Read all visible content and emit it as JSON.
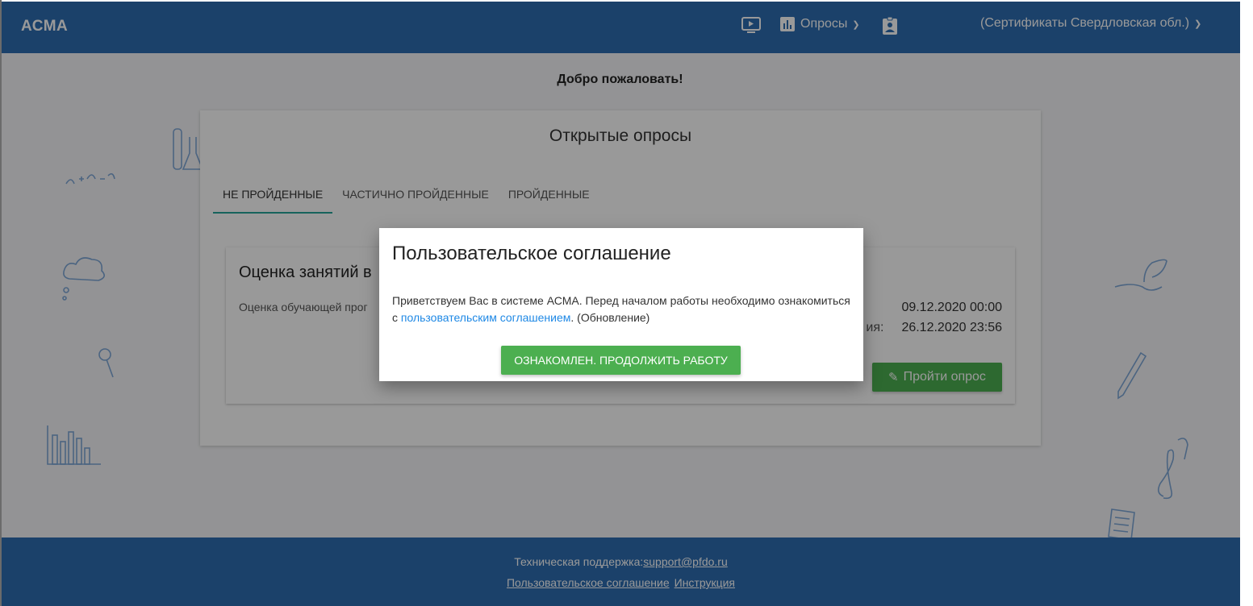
{
  "header": {
    "brand": "АСМА",
    "surveys_label": "Опросы",
    "account_label": "(Сертификаты Свердловская обл.)"
  },
  "main": {
    "welcome": "Добро пожаловать!",
    "card_title": "Открытые опросы",
    "tabs": [
      {
        "label": "НЕ ПРОЙДЕННЫЕ",
        "active": true
      },
      {
        "label": "ЧАСТИЧНО ПРОЙДЕННЫЕ",
        "active": false
      },
      {
        "label": "ПРОЙДЕННЫЕ",
        "active": false
      }
    ],
    "survey": {
      "title": "Оценка занятий в",
      "description": "Оценка обучающей прог",
      "date_start": "09.12.2020 00:00",
      "date_end_label": "ия:",
      "date_end": "26.12.2020 23:56",
      "start_button": "Пройти опрос"
    }
  },
  "modal": {
    "title": "Пользовательское соглашение",
    "text_before": "Приветствуем Вас в системе АСМА. Перед началом работы необходимо ознакомиться с ",
    "link_text": "пользовательским соглашением",
    "text_after": ". (Обновление)",
    "button": "ОЗНАКОМЛЕН. ПРОДОЛЖИТЬ РАБОТУ"
  },
  "footer": {
    "support_label": "Техническая поддержка:",
    "support_email": "support@pfdo.ru",
    "agreement_link": "Пользовательское соглашение",
    "instruction_link": "Инструкция"
  },
  "colors": {
    "header_bg": "#2e6db1",
    "accent_green": "#4caf50",
    "tab_indicator": "#26a69a",
    "link_blue": "#1e88e5"
  }
}
